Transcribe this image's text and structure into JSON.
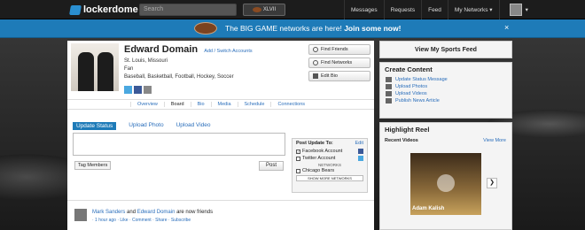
{
  "topbar": {
    "brand": "lockerdome",
    "search_placeholder": "Search",
    "xlvii_label": "XLVII",
    "nav": [
      "Messages",
      "Requests",
      "Feed",
      "My Networks ▾",
      "▾"
    ]
  },
  "banner": {
    "message_plain": "The BIG GAME networks are here!",
    "message_bold": "Join some now!",
    "close": "×"
  },
  "profile": {
    "name": "Edward Domain",
    "switch_link": "Add / Switch Accounts",
    "location": "St. Louis, Missouri",
    "role": "Fan",
    "sports": "Baseball, Basketball, Football, Hockey, Soccer",
    "buttons": [
      "Find Friends",
      "Find Networks",
      "Edit Bio"
    ]
  },
  "tabs": [
    "Overview",
    "Board",
    "Bio",
    "Media",
    "Schedule",
    "Connections"
  ],
  "status": {
    "tabs": [
      "Update Status",
      "Upload Photo",
      "Upload Video"
    ],
    "tag_members": "Tag Members",
    "post_button": "Post",
    "post_to": {
      "title": "Post Update To:",
      "edit": "Edit",
      "options": [
        "Facebook Account",
        "Twitter Account"
      ],
      "networks_label": "NETWORKS",
      "network_option": "Chicago Bears",
      "show_more": "SHOW MORE NETWORKS"
    }
  },
  "feed": {
    "name1": "Mark Sanders",
    "and": "and",
    "name2": "Edward Domain",
    "rest": "are now friends",
    "meta": "· 1 hour ago · Like · Comment · Share · Subscribe"
  },
  "right": {
    "sports_feed_button": "View My Sports Feed",
    "create_content_title": "Create Content",
    "create_items": [
      "Update Status Message",
      "Upload Photos",
      "Upload Videos",
      "Publish News Article"
    ],
    "highlight_title": "Highlight Reel",
    "recent_videos": "Recent Videos",
    "view_more": "View More",
    "video_caption": "Adam Kalish",
    "next_arrow": "❯"
  }
}
